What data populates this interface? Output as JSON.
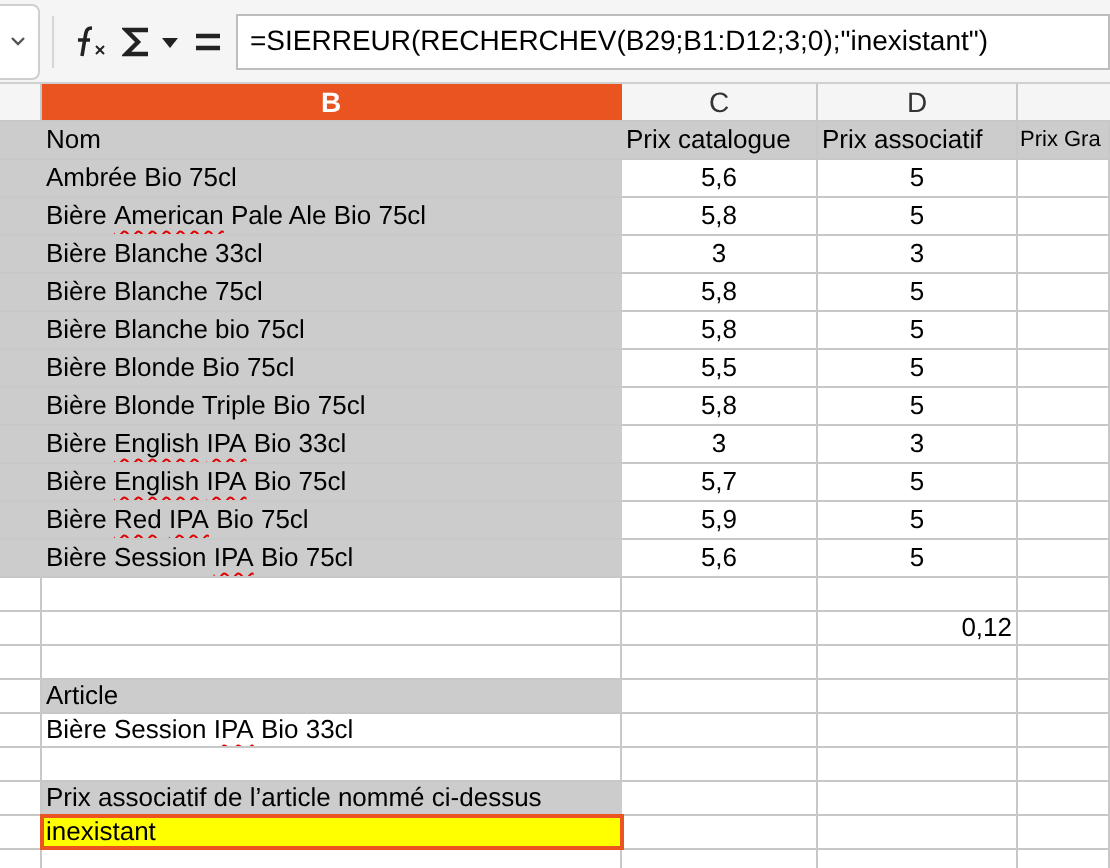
{
  "formula_bar": {
    "formula": "=SIERREUR(RECHERCHEV(B29;B1:D12;3;0);\"inexistant\")"
  },
  "columns": [
    {
      "label": "B",
      "selected": true
    },
    {
      "label": "C",
      "selected": false
    },
    {
      "label": "D",
      "selected": false
    }
  ],
  "rows": [
    {
      "kind": "header",
      "cells": [
        [
          {
            "text": "Nom"
          }
        ],
        "Prix catalogue",
        "Prix associatif",
        "Prix Gra"
      ]
    },
    {
      "kind": "item",
      "cells": [
        [
          {
            "text": "Ambrée Bio 75cl"
          }
        ],
        "5,6",
        "5"
      ]
    },
    {
      "kind": "item",
      "cells": [
        [
          {
            "text": "Bière "
          },
          {
            "text": "American",
            "misspelled": true
          },
          {
            "text": " Pale Ale Bio 75cl"
          }
        ],
        "5,8",
        "5"
      ]
    },
    {
      "kind": "item",
      "cells": [
        [
          {
            "text": "Bière Blanche 33cl"
          }
        ],
        "3",
        "3"
      ]
    },
    {
      "kind": "item",
      "cells": [
        [
          {
            "text": "Bière Blanche 75cl"
          }
        ],
        "5,8",
        "5"
      ]
    },
    {
      "kind": "item",
      "cells": [
        [
          {
            "text": "Bière Blanche bio 75cl"
          }
        ],
        "5,8",
        "5"
      ]
    },
    {
      "kind": "item",
      "cells": [
        [
          {
            "text": "Bière Blonde Bio 75cl"
          }
        ],
        "5,5",
        "5"
      ]
    },
    {
      "kind": "item",
      "cells": [
        [
          {
            "text": "Bière Blonde Triple Bio 75cl"
          }
        ],
        "5,8",
        "5"
      ]
    },
    {
      "kind": "item",
      "cells": [
        [
          {
            "text": "Bière "
          },
          {
            "text": "English",
            "misspelled": true
          },
          {
            "text": " "
          },
          {
            "text": "IPA",
            "misspelled": true
          },
          {
            "text": " Bio 33cl"
          }
        ],
        "3",
        "3"
      ]
    },
    {
      "kind": "item",
      "cells": [
        [
          {
            "text": "Bière "
          },
          {
            "text": "English",
            "misspelled": true
          },
          {
            "text": " "
          },
          {
            "text": "IPA",
            "misspelled": true
          },
          {
            "text": " Bio 75cl"
          }
        ],
        "5,7",
        "5"
      ]
    },
    {
      "kind": "item",
      "cells": [
        [
          {
            "text": "Bière "
          },
          {
            "text": "Red",
            "misspelled": true
          },
          {
            "text": " "
          },
          {
            "text": "IPA",
            "misspelled": true
          },
          {
            "text": " Bio 75cl"
          }
        ],
        "5,9",
        "5"
      ]
    },
    {
      "kind": "item",
      "cells": [
        [
          {
            "text": "Bière Session "
          },
          {
            "text": "IPA",
            "misspelled": true
          },
          {
            "text": " Bio 75cl"
          }
        ],
        "5,6",
        "5"
      ]
    },
    {
      "kind": "plain",
      "cells": []
    },
    {
      "kind": "plain",
      "cells": [
        [],
        "",
        "0,12"
      ]
    },
    {
      "kind": "plain",
      "cells": []
    },
    {
      "kind": "label",
      "cells": [
        [
          {
            "text": "Article"
          }
        ]
      ]
    },
    {
      "kind": "plain",
      "cells": [
        [
          {
            "text": "Bière Session "
          },
          {
            "text": "IPA",
            "misspelled": true
          },
          {
            "text": " Bio 33cl"
          }
        ]
      ]
    },
    {
      "kind": "plain",
      "cells": []
    },
    {
      "kind": "label",
      "cells": [
        [
          {
            "text": "Prix associatif de l’article nommé ci-dessus"
          }
        ]
      ]
    },
    {
      "kind": "result",
      "selected": true,
      "cells": [
        [
          {
            "text": "inexistant"
          }
        ]
      ]
    },
    {
      "kind": "plain",
      "cells": []
    }
  ]
}
